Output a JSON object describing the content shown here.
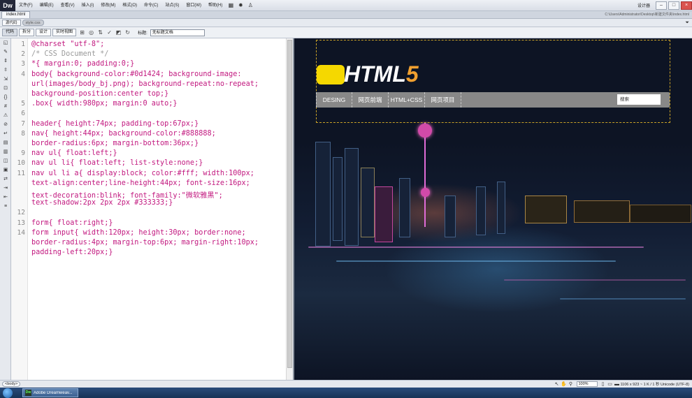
{
  "app": {
    "logo": "Dw",
    "menus": [
      "文件(F)",
      "编辑(E)",
      "查看(V)",
      "插入(I)",
      "修改(M)",
      "格式(O)",
      "命令(C)",
      "站点(S)",
      "窗口(W)",
      "帮助(H)"
    ],
    "workspace": "设计器",
    "tab": "index.html",
    "path": "C:\\Users\\Administrator\\Desktop\\新建文件夹\\index.html",
    "related": [
      "源代码",
      "style.css"
    ],
    "view_buttons": [
      "代码",
      "拆分",
      "设计",
      "实时视图"
    ],
    "title_label": "标题:",
    "title_value": "无标题文档"
  },
  "code": [
    {
      "n": "1",
      "text": "@charset \"utf-8\";"
    },
    {
      "n": "2",
      "text": "/* CSS Document */"
    },
    {
      "n": "3",
      "text": "*{ margin:0; padding:0;}"
    },
    {
      "n": "4",
      "text": "body{ background-color:#0d1424; background-image:"
    },
    {
      "n": "",
      "text": "url(images/body_bj.png); background-repeat:no-repeat;"
    },
    {
      "n": "",
      "text": "background-position:center top;}"
    },
    {
      "n": "5",
      "text": ".box{ width:980px; margin:0 auto;}"
    },
    {
      "n": "6",
      "text": ""
    },
    {
      "n": "7",
      "text": "header{ height:74px; padding-top:67px;}"
    },
    {
      "n": "8",
      "text": "nav{ height:44px; background-color:#888888;"
    },
    {
      "n": "",
      "text": "border-radius:6px; margin-bottom:36px;}"
    },
    {
      "n": "9",
      "text": "nav ul{ float:left;}"
    },
    {
      "n": "10",
      "text": "nav ul li{ float:left; list-style:none;}"
    },
    {
      "n": "11",
      "text": "nav ul li a{ display:block; color:#fff; width:100px;"
    },
    {
      "n": "",
      "text": "text-align:center;line-height:44px; font-size:16px;"
    },
    {
      "n": "",
      "text": "text-decoration:blink; font-family:\"微软雅黑\";"
    },
    {
      "n": "",
      "text": "text-shadow:2px 2px 2px #333333;}"
    },
    {
      "n": "12",
      "text": ""
    },
    {
      "n": "13",
      "text": "form{ float:right;}"
    },
    {
      "n": "14",
      "text": "form input{ width:120px; height:30px; border:none;"
    },
    {
      "n": "",
      "text": "border-radius:4px; margin-top:6px; margin-right:10px;"
    },
    {
      "n": "",
      "text": "padding-left:20px;}"
    }
  ],
  "design": {
    "logo_text": "HTML",
    "logo_five": "5",
    "nav_items": [
      "DESING",
      "网页前端",
      "HTML+CSS",
      "网页项目"
    ],
    "search_placeholder": "搜索"
  },
  "status": {
    "tag": "<body>",
    "zoom": "100%",
    "info": "1106 x 923 ~ 1 K / 1 秒 Unicode (UTF-8)"
  },
  "taskbar": {
    "app_label": "Adobe Dreamweav..."
  }
}
